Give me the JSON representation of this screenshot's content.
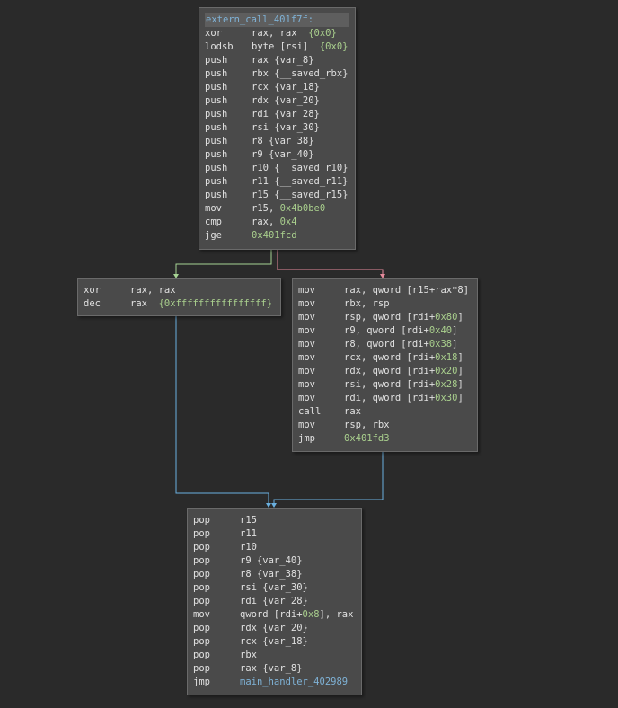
{
  "colors": {
    "background": "#2a2a2a",
    "block_bg": "#4a4a4a",
    "block_border": "#6a6a6a",
    "text": "#e0e0e0",
    "hex_literal": "#a9cf8d",
    "symbol": "#7fb2d6",
    "edge_true": "#a7d494",
    "edge_false": "#e58b9c",
    "edge_unconditional": "#6ab0e0"
  },
  "blocks": [
    {
      "id": "entry",
      "header": "extern_call_401f7f:",
      "lines": [
        {
          "m": "xor",
          "segs": [
            {
              "t": "rax, rax  "
            },
            {
              "t": "{0x0}",
              "c": "hex"
            }
          ]
        },
        {
          "m": "lodsb",
          "segs": [
            {
              "t": "byte [rsi]  "
            },
            {
              "t": "{0x0}",
              "c": "hex"
            }
          ]
        },
        {
          "m": "push",
          "segs": [
            {
              "t": "rax {var_8}"
            }
          ]
        },
        {
          "m": "push",
          "segs": [
            {
              "t": "rbx {__saved_rbx}"
            }
          ]
        },
        {
          "m": "push",
          "segs": [
            {
              "t": "rcx {var_18}"
            }
          ]
        },
        {
          "m": "push",
          "segs": [
            {
              "t": "rdx {var_20}"
            }
          ]
        },
        {
          "m": "push",
          "segs": [
            {
              "t": "rdi {var_28}"
            }
          ]
        },
        {
          "m": "push",
          "segs": [
            {
              "t": "rsi {var_30}"
            }
          ]
        },
        {
          "m": "push",
          "segs": [
            {
              "t": "r8 {var_38}"
            }
          ]
        },
        {
          "m": "push",
          "segs": [
            {
              "t": "r9 {var_40}"
            }
          ]
        },
        {
          "m": "push",
          "segs": [
            {
              "t": "r10 {__saved_r10}"
            }
          ]
        },
        {
          "m": "push",
          "segs": [
            {
              "t": "r11 {__saved_r11}"
            }
          ]
        },
        {
          "m": "push",
          "segs": [
            {
              "t": "r15 {__saved_r15}"
            }
          ]
        },
        {
          "m": "mov",
          "segs": [
            {
              "t": "r15, "
            },
            {
              "t": "0x4b0be0",
              "c": "hex"
            }
          ]
        },
        {
          "m": "cmp",
          "segs": [
            {
              "t": "rax, "
            },
            {
              "t": "0x4",
              "c": "hex"
            }
          ]
        },
        {
          "m": "jge",
          "segs": [
            {
              "t": "0x401fcd",
              "c": "hex"
            }
          ]
        }
      ]
    },
    {
      "id": "left",
      "lines": [
        {
          "m": "xor",
          "segs": [
            {
              "t": "rax, rax"
            }
          ]
        },
        {
          "m": "dec",
          "segs": [
            {
              "t": "rax  "
            },
            {
              "t": "{0xffffffffffffffff}",
              "c": "hex"
            }
          ]
        }
      ]
    },
    {
      "id": "right",
      "lines": [
        {
          "m": "mov",
          "segs": [
            {
              "t": "rax, qword [r15+rax*8]"
            }
          ]
        },
        {
          "m": "mov",
          "segs": [
            {
              "t": "rbx, rsp"
            }
          ]
        },
        {
          "m": "mov",
          "segs": [
            {
              "t": "rsp, qword [rdi+"
            },
            {
              "t": "0x80",
              "c": "hex"
            },
            {
              "t": "]"
            }
          ]
        },
        {
          "m": "mov",
          "segs": [
            {
              "t": "r9, qword [rdi+"
            },
            {
              "t": "0x40",
              "c": "hex"
            },
            {
              "t": "]"
            }
          ]
        },
        {
          "m": "mov",
          "segs": [
            {
              "t": "r8, qword [rdi+"
            },
            {
              "t": "0x38",
              "c": "hex"
            },
            {
              "t": "]"
            }
          ]
        },
        {
          "m": "mov",
          "segs": [
            {
              "t": "rcx, qword [rdi+"
            },
            {
              "t": "0x18",
              "c": "hex"
            },
            {
              "t": "]"
            }
          ]
        },
        {
          "m": "mov",
          "segs": [
            {
              "t": "rdx, qword [rdi+"
            },
            {
              "t": "0x20",
              "c": "hex"
            },
            {
              "t": "]"
            }
          ]
        },
        {
          "m": "mov",
          "segs": [
            {
              "t": "rsi, qword [rdi+"
            },
            {
              "t": "0x28",
              "c": "hex"
            },
            {
              "t": "]"
            }
          ]
        },
        {
          "m": "mov",
          "segs": [
            {
              "t": "rdi, qword [rdi+"
            },
            {
              "t": "0x30",
              "c": "hex"
            },
            {
              "t": "]"
            }
          ]
        },
        {
          "m": "call",
          "segs": [
            {
              "t": "rax"
            }
          ]
        },
        {
          "m": "mov",
          "segs": [
            {
              "t": "rsp, rbx"
            }
          ]
        },
        {
          "m": "jmp",
          "segs": [
            {
              "t": "0x401fd3",
              "c": "hex"
            }
          ]
        }
      ]
    },
    {
      "id": "exit",
      "lines": [
        {
          "m": "pop",
          "segs": [
            {
              "t": "r15"
            }
          ]
        },
        {
          "m": "pop",
          "segs": [
            {
              "t": "r11"
            }
          ]
        },
        {
          "m": "pop",
          "segs": [
            {
              "t": "r10"
            }
          ]
        },
        {
          "m": "pop",
          "segs": [
            {
              "t": "r9 {var_40}"
            }
          ]
        },
        {
          "m": "pop",
          "segs": [
            {
              "t": "r8 {var_38}"
            }
          ]
        },
        {
          "m": "pop",
          "segs": [
            {
              "t": "rsi {var_30}"
            }
          ]
        },
        {
          "m": "pop",
          "segs": [
            {
              "t": "rdi {var_28}"
            }
          ]
        },
        {
          "m": "mov",
          "segs": [
            {
              "t": "qword [rdi+"
            },
            {
              "t": "0x8",
              "c": "hex"
            },
            {
              "t": "], rax"
            }
          ]
        },
        {
          "m": "pop",
          "segs": [
            {
              "t": "rdx {var_20}"
            }
          ]
        },
        {
          "m": "pop",
          "segs": [
            {
              "t": "rcx {var_18}"
            }
          ]
        },
        {
          "m": "pop",
          "segs": [
            {
              "t": "rbx"
            }
          ]
        },
        {
          "m": "pop",
          "segs": [
            {
              "t": "rax {var_8}"
            }
          ]
        },
        {
          "m": "jmp",
          "segs": [
            {
              "t": "main_handler_402989",
              "c": "sym"
            }
          ]
        }
      ]
    }
  ]
}
